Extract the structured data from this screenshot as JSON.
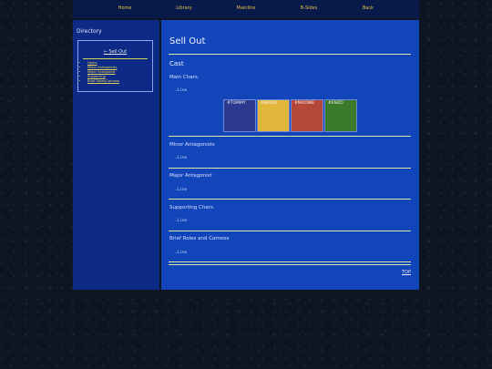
{
  "nav": {
    "links": [
      "Home",
      "Library",
      "Mainline",
      "B-Sides",
      "Back"
    ]
  },
  "sidebar": {
    "title": "Directory",
    "current_page": "← Sell Out",
    "links": [
      "Home",
      "Minor Antagonists",
      "Major Antagonist",
      "Supporting",
      "Brief Roles/Cameos"
    ]
  },
  "main": {
    "title": "Sell Out",
    "cast_heading": "Cast",
    "sections": [
      {
        "heading": "Main Chars.",
        "line_text": " .Line"
      },
      {
        "heading": "Minor Antagonists",
        "line_text": " .Line"
      },
      {
        "heading": "Major Antagonist",
        "line_text": " .Line"
      },
      {
        "heading": "Supporting Chars.",
        "line_text": " .Line"
      },
      {
        "heading": "Brief Roles and Cameos",
        "line_text": " .Line"
      }
    ],
    "characters": [
      {
        "name": "#TOMMY",
        "color": "#2b3a8f"
      },
      {
        "name": "#BIRDIE",
        "color": "#e0b73a"
      },
      {
        "name": "#MOONIE",
        "color": "#b5463a"
      },
      {
        "name": "#ENZO",
        "color": "#3b7a2a"
      }
    ],
    "top_link": "TOP"
  }
}
